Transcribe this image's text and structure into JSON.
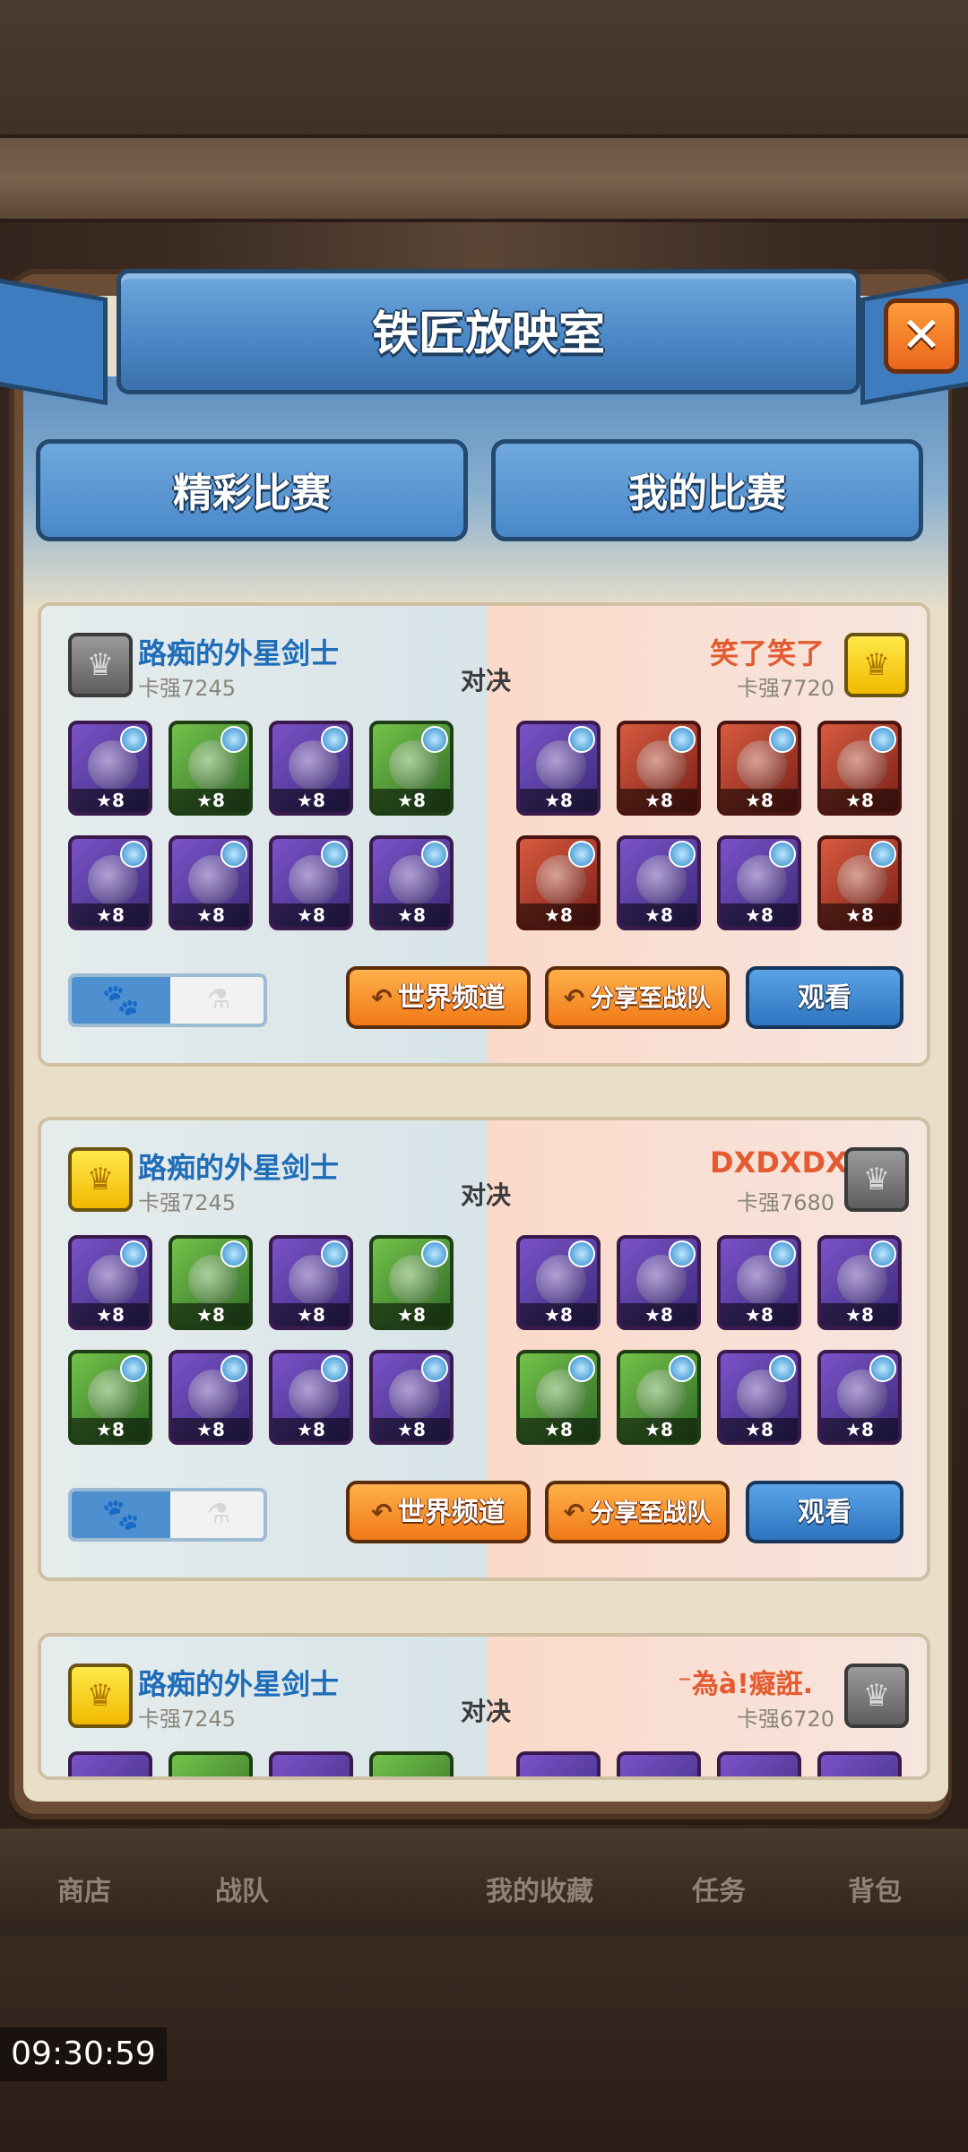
{
  "dialog": {
    "title": "铁匠放映室",
    "close_label": "✕"
  },
  "tabs": [
    {
      "label": "精彩比赛"
    },
    {
      "label": "我的比赛"
    }
  ],
  "vs_label": "对决",
  "buttons": {
    "world_channel": "世界频道",
    "share_team": "分享至战队",
    "watch": "观看"
  },
  "matches": [
    {
      "left_player": {
        "name": "路痴的外星剑士",
        "power": "卡强7245",
        "badge": "silver"
      },
      "right_player": {
        "name": "笑了笑了",
        "power": "卡强7720",
        "badge": "gold"
      },
      "left_heroes": [
        "★8",
        "★8",
        "★8",
        "★8",
        "★8",
        "★8",
        "★8",
        "★8"
      ],
      "right_heroes": [
        "★8",
        "★8",
        "★8",
        "★8",
        "★8",
        "★8",
        "★8",
        "★8"
      ]
    },
    {
      "left_player": {
        "name": "路痴的外星剑士",
        "power": "卡强7245",
        "badge": "gold"
      },
      "right_player": {
        "name": "DXDXDX",
        "power": "卡强7680",
        "badge": "silver"
      },
      "left_heroes": [
        "★8",
        "★8",
        "★8",
        "★8",
        "★8",
        "★8",
        "★8",
        "★8"
      ],
      "right_heroes": [
        "★8",
        "★8",
        "★8",
        "★8",
        "★8",
        "★8",
        "★8",
        "★8"
      ]
    },
    {
      "left_player": {
        "name": "路痴的外星剑士",
        "power": "卡强7245",
        "badge": "gold"
      },
      "right_player": {
        "name": "⁻為à!癡誑.",
        "power": "卡强6720",
        "badge": "silver"
      }
    }
  ],
  "bottom_nav": [
    "商店",
    "战队",
    "我的收藏",
    "任务",
    "背包"
  ],
  "status": {
    "clock": "09:30:59"
  },
  "colors": {
    "accent_blue": "#4a86c5",
    "accent_orange": "#f07a16",
    "name_blue": "#1f6db8",
    "name_red": "#e35b31"
  }
}
